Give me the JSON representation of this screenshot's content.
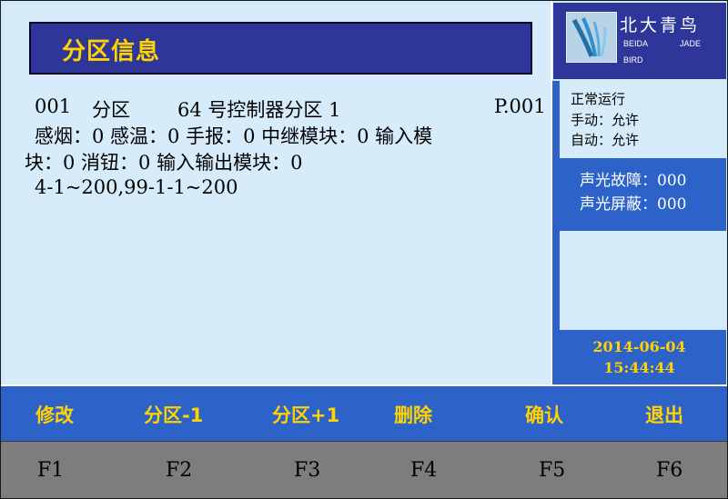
{
  "title": "分区信息",
  "zone": {
    "number": "001",
    "type_label": "分区",
    "name": "64 号控制器分区 1",
    "page": "P.001",
    "line2": "感烟：0   感温：0   手报：0   中继模块：0   输入模",
    "line3": "块：0   消钮：0   输入输出模块：0",
    "address_range": "4-1~200,99-1-1~200"
  },
  "brand": {
    "cn": "北大青鸟",
    "en_left": "BEIDA",
    "en_right": "JADE",
    "en_bottom": "BIRD"
  },
  "status": {
    "run": "正常运行",
    "manual": "手动：允许",
    "auto": "自动：允许"
  },
  "alarm": {
    "fault": "声光故障：000",
    "mask": "声光屏蔽：000"
  },
  "datetime": {
    "date": "2014-06-04",
    "time": "15:44:44"
  },
  "menu": [
    {
      "label": "修改"
    },
    {
      "label": "分区-1"
    },
    {
      "label": "分区+1"
    },
    {
      "label": "删除"
    },
    {
      "label": "确认"
    },
    {
      "label": "退出"
    }
  ],
  "fkeys": [
    {
      "label": "F1"
    },
    {
      "label": "F2"
    },
    {
      "label": "F3"
    },
    {
      "label": "F4"
    },
    {
      "label": "F5"
    },
    {
      "label": "F6"
    }
  ],
  "colors": {
    "title_bg": "#2f3699",
    "accent_blue": "#2d63c9",
    "text_yellow": "#ffd200",
    "panel_bg": "#d6ecfb",
    "fkey_bg": "#7d7d7d"
  },
  "icons": {
    "logo": "beida-jade-bird-logo-icon"
  }
}
